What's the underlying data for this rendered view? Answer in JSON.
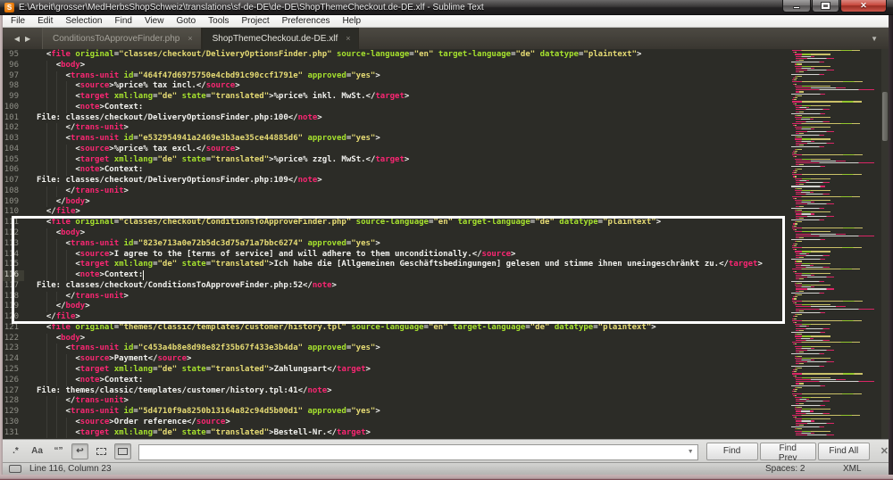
{
  "window": {
    "title": "E:\\Arbeit\\grosser\\MedHerbsShopSchweiz\\translations\\sf-de-DE\\de-DE\\ShopThemeCheckout.de-DE.xlf - Sublime Text",
    "app_icon": "sublime-text-logo",
    "controls": [
      "minimize",
      "maximize",
      "close"
    ]
  },
  "menu": {
    "items": [
      "File",
      "Edit",
      "Selection",
      "Find",
      "View",
      "Goto",
      "Tools",
      "Project",
      "Preferences",
      "Help"
    ]
  },
  "tab_bar": {
    "tabs": [
      {
        "label": "ConditionsToApproveFinder.php",
        "active": false
      },
      {
        "label": "ShopThemeCheckout.de-DE.xlf",
        "active": true
      }
    ]
  },
  "editor": {
    "first_line_number": 95,
    "cursor": {
      "line": 116,
      "column": 23
    },
    "highlight_box": {
      "from_line": 111,
      "to_line": 120
    },
    "lines": [
      "  <file original=\"classes/checkout/DeliveryOptionsFinder.php\" source-language=\"en\" target-language=\"de\" datatype=\"plaintext\">",
      "    <body>",
      "      <trans-unit id=\"464f47d6975750e4cbd91c90ccf1791e\" approved=\"yes\">",
      "        <source>%price% tax incl.</source>",
      "        <target xml:lang=\"de\" state=\"translated\">%price% inkl. MwSt.</target>",
      "        <note>Context:",
      "File: classes/checkout/DeliveryOptionsFinder.php:100</note>",
      "      </trans-unit>",
      "      <trans-unit id=\"e532954941a2469e3b3ae35ce44885d6\" approved=\"yes\">",
      "        <source>%price% tax excl.</source>",
      "        <target xml:lang=\"de\" state=\"translated\">%price% zzgl. MwSt.</target>",
      "        <note>Context:",
      "File: classes/checkout/DeliveryOptionsFinder.php:109</note>",
      "      </trans-unit>",
      "    </body>",
      "  </file>",
      "  <file original=\"classes/checkout/ConditionsToApproveFinder.php\" source-language=\"en\" target-language=\"de\" datatype=\"plaintext\">",
      "    <body>",
      "      <trans-unit id=\"823e713a0e72b5dc3d75a71a7bbc6274\" approved=\"yes\">",
      "        <source>I agree to the [terms of service] and will adhere to them unconditionally.</source>",
      "        <target xml:lang=\"de\" state=\"translated\">Ich habe die [Allgemeinen Geschäftsbedingungen] gelesen und stimme ihnen uneingeschränkt zu.</target>",
      "        <note>Context:",
      "File: classes/checkout/ConditionsToApproveFinder.php:52</note>",
      "      </trans-unit>",
      "    </body>",
      "  </file>",
      "  <file original=\"themes/classic/templates/customer/history.tpl\" source-language=\"en\" target-language=\"de\" datatype=\"plaintext\">",
      "    <body>",
      "      <trans-unit id=\"c453a4b8e8d98e82f35b67f433e3b4da\" approved=\"yes\">",
      "        <source>Payment</source>",
      "        <target xml:lang=\"de\" state=\"translated\">Zahlungsart</target>",
      "        <note>Context:",
      "File: themes/classic/templates/customer/history.tpl:41</note>",
      "      </trans-unit>",
      "      <trans-unit id=\"5d4710f9a8250b13164a82c94d5b00d1\" approved=\"yes\">",
      "        <source>Order reference</source>",
      "        <target xml:lang=\"de\" state=\"translated\">Bestell-Nr.</target>"
    ]
  },
  "find_bar": {
    "toggles": [
      {
        "name": "regex-toggle",
        "label": ".*",
        "active": false
      },
      {
        "name": "case-sensitive-toggle",
        "label": "Aa",
        "active": false
      },
      {
        "name": "whole-word-toggle",
        "label": "“”",
        "active": false
      },
      {
        "name": "wrap-toggle",
        "label": "↩",
        "active": true
      },
      {
        "name": "in-selection-toggle",
        "label": "",
        "active": false
      },
      {
        "name": "highlight-matches-toggle",
        "label": "",
        "active": true
      }
    ],
    "query": "",
    "buttons": [
      "Find",
      "Find Prev",
      "Find All"
    ]
  },
  "status_bar": {
    "position": "Line 116, Column 23",
    "indent": "Spaces: 2",
    "syntax": "XML"
  },
  "theme": {
    "bg": "#2c2c27",
    "tag": "#f92672",
    "attr": "#a6e22e",
    "string": "#e6db74",
    "text": "#f2f2ef",
    "gutter": "#8f8f87",
    "accent_orange": "#e07000"
  }
}
